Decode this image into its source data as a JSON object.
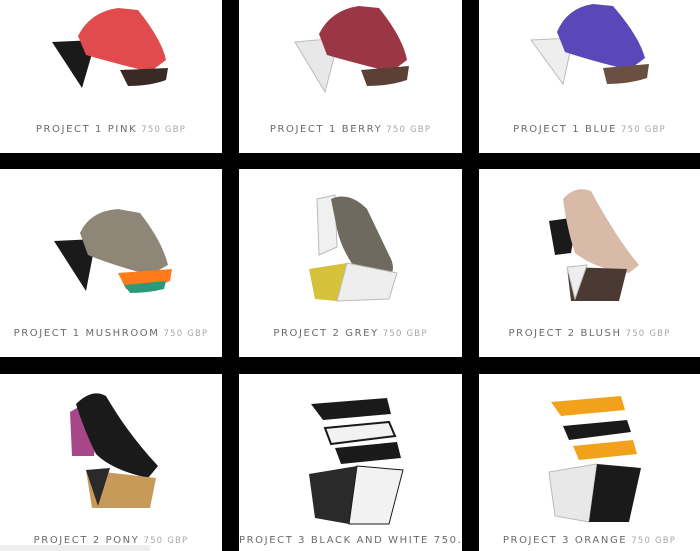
{
  "products": [
    {
      "name": "PROJECT 1 PINK",
      "price": "750 GBP",
      "colors": {
        "upper": "#e04b4e",
        "heel": "#1a1a1a",
        "platform": "#3a2a25"
      }
    },
    {
      "name": "PROJECT 1 BERRY",
      "price": "750 GBP",
      "colors": {
        "upper": "#9b3645",
        "heel": "#e8e8e8",
        "platform": "#5a4035"
      }
    },
    {
      "name": "PROJECT 1 BLUE",
      "price": "750 GBP",
      "colors": {
        "upper": "#5a48b8",
        "heel": "#eeeeee",
        "platform": "#6a5040"
      }
    },
    {
      "name": "PROJECT 1 MUSHROOM",
      "price": "750 GBP",
      "colors": {
        "upper": "#8e8677",
        "heel": "#1a1a1a",
        "platform": "#ff7a1a"
      }
    },
    {
      "name": "PROJECT 2 GREY",
      "price": "750 GBP",
      "colors": {
        "upper": "#6e6a60",
        "heel": "#f0f0f0",
        "platform": "#d6c23a"
      }
    },
    {
      "name": "PROJECT 2 BLUSH",
      "price": "750 GBP",
      "colors": {
        "upper": "#d9b9a8",
        "heel": "#1a1a1a",
        "platform": "#4a3a33"
      }
    },
    {
      "name": "PROJECT 2 PONY",
      "price": "750 GBP",
      "colors": {
        "upper": "#1a1a1a",
        "heel": "#a8468a",
        "platform": "#c89a5a"
      }
    },
    {
      "name": "PROJECT 3 BLACK AND WHITE 750...",
      "price": "",
      "colors": {
        "upper": "#1a1a1a",
        "heel": "#f2f2f2",
        "platform": "#2a2a2a"
      }
    },
    {
      "name": "PROJECT 3 ORANGE",
      "price": "750 GBP",
      "colors": {
        "upper": "#f2a21a",
        "heel": "#1a1a1a",
        "platform": "#e8e8e8"
      }
    }
  ]
}
